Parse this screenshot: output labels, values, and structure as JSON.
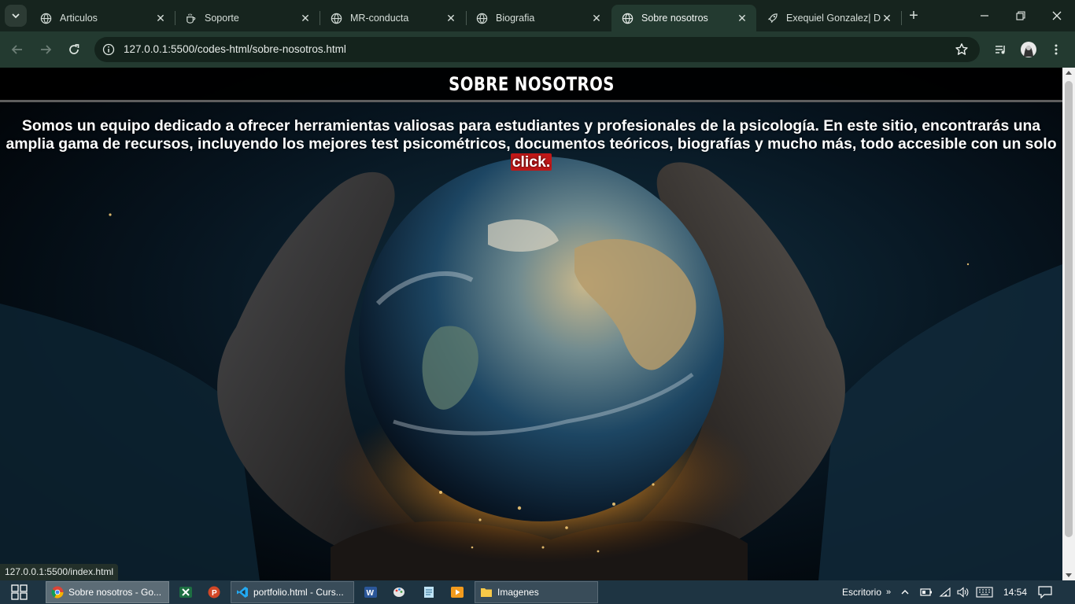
{
  "browser": {
    "tabs": [
      {
        "title": "Articulos",
        "icon": "globe-icon",
        "active": false
      },
      {
        "title": "Soporte",
        "icon": "coffee-icon",
        "active": false
      },
      {
        "title": "MR-conducta",
        "icon": "globe-icon",
        "active": false
      },
      {
        "title": "Biografia",
        "icon": "globe-icon",
        "active": false
      },
      {
        "title": "Sobre nosotros",
        "icon": "globe-icon",
        "active": true
      },
      {
        "title": "Exequiel Gonzalez| De",
        "icon": "rocket-icon",
        "active": false
      }
    ],
    "url": "127.0.0.1:5500/codes-html/sobre-nosotros.html",
    "status_url": "127.0.0.1:5500/index.html",
    "colors": {
      "frame": "#16241e",
      "toolbar": "#233a30",
      "omnibox": "#14231c"
    }
  },
  "page": {
    "title": "SOBRE NOSOTROS",
    "intro_text": "Somos un equipo dedicado a ofrecer herramientas valiosas para estudiantes y profesionales de la psicología. En este sitio, encontrarás una amplia gama de recursos, incluyendo los mejores test psicométricos, documentos teóricos, biografías y mucho más, todo accesible con un solo",
    "highlight": "click.",
    "background": "hands-holding-earth-image",
    "colors": {
      "highlight": "#c01818",
      "text": "#ffffff"
    }
  },
  "taskbar": {
    "windows": [
      {
        "title": "Sobre nosotros - Go...",
        "icon": "chrome-icon",
        "active": true
      },
      {
        "title": "portfolio.html - Curs...",
        "icon": "vscode-icon",
        "active": false
      },
      {
        "title": "Imagenes",
        "icon": "folder-icon",
        "active": false
      }
    ],
    "pinned": [
      "excel-icon",
      "powerpoint-icon",
      "word-icon",
      "paint-icon",
      "notepad-icon",
      "media-player-icon"
    ],
    "desktop_label": "Escritorio",
    "time": "14:54"
  }
}
